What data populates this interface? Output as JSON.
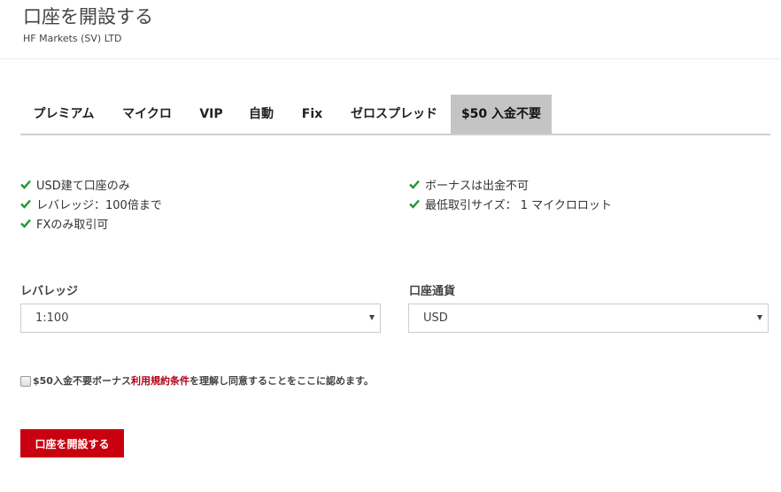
{
  "header": {
    "title": "口座を開設する",
    "subtitle": "HF Markets (SV) LTD"
  },
  "tabs": [
    {
      "label": "プレミアム",
      "active": false
    },
    {
      "label": "マイクロ",
      "active": false
    },
    {
      "label": "VIP",
      "active": false
    },
    {
      "label": "自動",
      "active": false
    },
    {
      "label": "Fix",
      "active": false
    },
    {
      "label": "ゼロスプレッド",
      "active": false
    },
    {
      "label": "$50 入金不要",
      "active": true
    }
  ],
  "features": {
    "left": [
      "USD建て口座のみ",
      "レバレッジ：100倍まで",
      "FXのみ取引可"
    ],
    "right": [
      "ボーナスは出金不可",
      "最低取引サイズ： 1 マイクロロット"
    ],
    "check_color": "#1e9637",
    "check_icon": "check-icon"
  },
  "form": {
    "leverage": {
      "label": "レバレッジ",
      "value": "1:100"
    },
    "currency": {
      "label": "口座通貨",
      "value": "USD"
    }
  },
  "agreement": {
    "prefix": "$50入金不要ボーナス",
    "link": "利用規約条件",
    "suffix": "を理解し同意することをここに認めます。",
    "checked": false,
    "link_color": "#b00016"
  },
  "submit_label": "口座を開設する",
  "colors": {
    "accent": "#c8000f",
    "active_tab": "#c4c4c4"
  }
}
